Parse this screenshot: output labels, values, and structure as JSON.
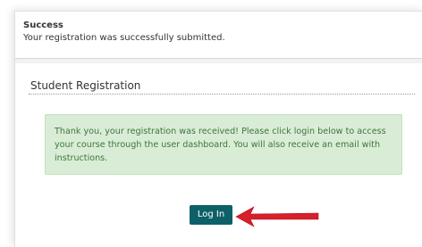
{
  "success": {
    "title": "Success",
    "message": "Your registration was successfully submitted."
  },
  "registration": {
    "section_title": "Student Registration",
    "alert_text": "Thank you, your registration was received! Please click login below to access your course through the user dashboard. You will also receive an email with instructions."
  },
  "actions": {
    "login_label": "Log In"
  },
  "annotation": {
    "arrow_icon": "red-arrow-icon",
    "arrow_color": "#d6202a"
  },
  "colors": {
    "button": "#0d6068",
    "alert_bg": "#d9edd6",
    "alert_text": "#3c763d"
  }
}
